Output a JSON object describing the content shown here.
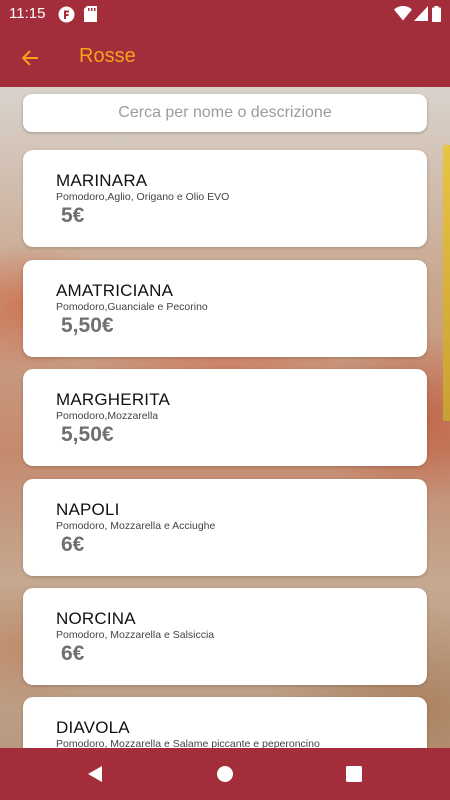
{
  "status_bar": {
    "time": "11:15"
  },
  "app_bar": {
    "title": "Rosse"
  },
  "search": {
    "placeholder": "Cerca per nome o descrizione",
    "value": ""
  },
  "items": [
    {
      "name": "MARINARA",
      "description": "Pomodoro,Aglio, Origano e Olio EVO",
      "price": "5€"
    },
    {
      "name": "AMATRICIANA",
      "description": "Pomodoro,Guanciale e Pecorino",
      "price": "5,50€"
    },
    {
      "name": "MARGHERITA",
      "description": "Pomodoro,Mozzarella",
      "price": "5,50€"
    },
    {
      "name": "NAPOLI",
      "description": "Pomodoro, Mozzarella e Acciughe",
      "price": "6€"
    },
    {
      "name": "NORCINA",
      "description": "Pomodoro, Mozzarella e Salsiccia",
      "price": "6€"
    },
    {
      "name": "DIAVOLA",
      "description": "Pomodoro, Mozzarella e Salame piccante e peperoncino",
      "price": ""
    }
  ],
  "colors": {
    "primary": "#a42d3b",
    "accent": "#f4a31a",
    "price": "#707070"
  },
  "icons": [
    "back-arrow-icon",
    "nav-back-icon",
    "nav-home-icon",
    "nav-recents-icon",
    "wifi-icon",
    "battery-icon",
    "signal-icon"
  ]
}
